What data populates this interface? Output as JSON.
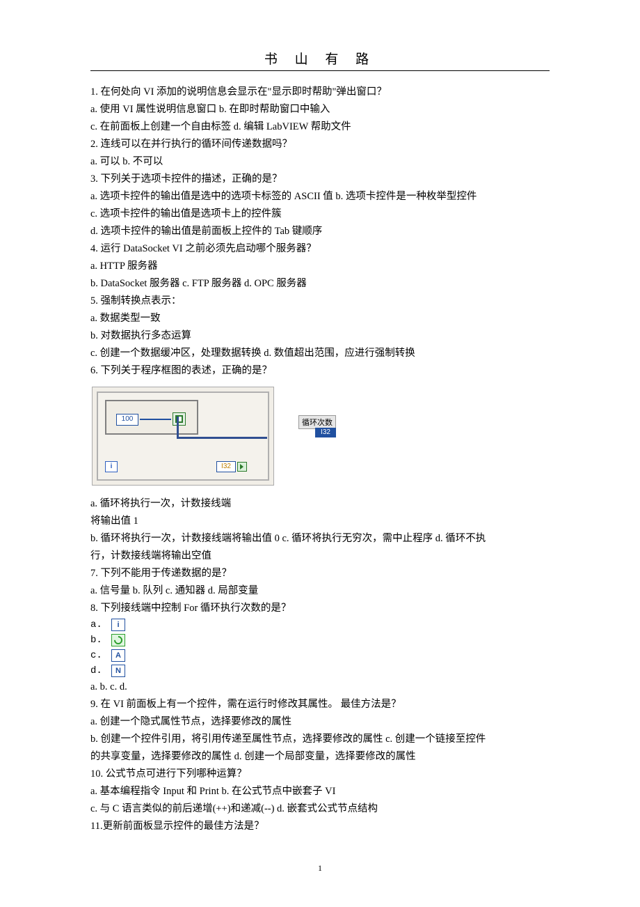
{
  "header": "书 山 有 路",
  "lines": [
    "1. 在何处向 VI 添加的说明信息会显示在\"显示即时帮助\"弹出窗口？",
    "a. 使用 VI 属性说明信息窗口 b. 在即时帮助窗口中输入",
    "c. 在前面板上创建一个自由标签 d. 编辑 LabVIEW 帮助文件",
    "2. 连线可以在并行执行的循环间传递数据吗？",
    "a. 可以 b. 不可以",
    "3. 下列关于选项卡控件的描述，正确的是？",
    "a. 选项卡控件的输出值是选中的选项卡标签的 ASCII 值 b. 选项卡控件是一种枚举型控件",
    "c. 选项卡控件的输出值是选项卡上的控件簇",
    "d. 选项卡控件的输出值是前面板上控件的 Tab 键顺序",
    "4. 运行 DataSocket VI 之前必须先启动哪个服务器？",
    "a. HTTP 服务器",
    "b. DataSocket 服务器 c. FTP 服务器 d. OPC 服务器",
    "5. 强制转换点表示：",
    "a. 数据类型一致",
    "b. 对数据执行多态运算",
    "c. 创建一个数据缓冲区，处理数据转换 d. 数值超出范围，应进行强制转换",
    "6. 下列关于程序框图的表述，正确的是？"
  ],
  "diagram": {
    "hundred": "100",
    "i_term": "i",
    "i32_term": "I32",
    "count_label": "循环次数",
    "i32_out": "I32"
  },
  "lines2": [
    "a. 循环将执行一次，计数接线端",
    "将输出值 1",
    "b. 循环将执行一次，计数接线端将输出值  0 c. 循环将执行无穷次，需中止程序 d. 循环不执",
    "行，计数接线端将输出空值",
    "7. 下列不能用于传递数据的是？",
    "a. 信号量 b. 队列 c. 通知器 d. 局部变量",
    "8. 下列接线端中控制 For 循环执行次数的是？"
  ],
  "options8": {
    "a": "a.",
    "b": "b.",
    "c": "c.",
    "d": "d.",
    "icon_i": "i",
    "icon_a": "A",
    "icon_n": "N"
  },
  "lines3": [
    "a.  b.  c.  d.",
    "9. 在 VI 前面板上有一个控件，需在运行时修改其属性。 最佳方法是？",
    "a. 创建一个隐式属性节点，选择要修改的属性",
    "b. 创建一个控件引用，将引用传递至属性节点，选择要修改的属性 c. 创建一个链接至控件",
    "的共享变量，选择要修改的属性 d. 创建一个局部变量，选择要修改的属性",
    "10. 公式节点可进行下列哪种运算？",
    "a. 基本编程指令 Input 和 Print b. 在公式节点中嵌套子 VI",
    "c. 与 C 语言类似的前后递增(++)和递减(--) d. 嵌套式公式节点结构",
    "11.更新前面板显示控件的最佳方法是？"
  ],
  "page_num": "1"
}
